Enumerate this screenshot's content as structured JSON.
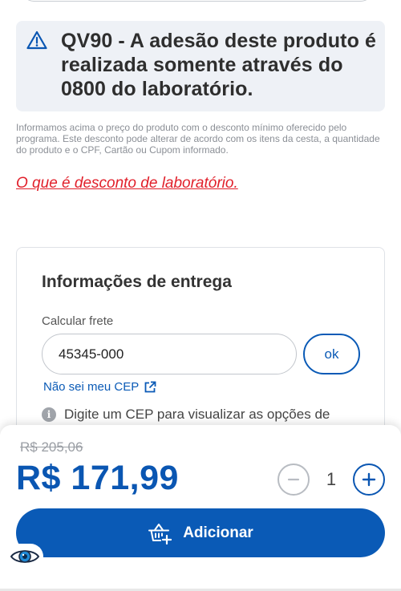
{
  "alert": {
    "icon": "warning-triangle-icon",
    "message": "QV90 - A adesão deste produto é realizada somente através do 0800 do laboratório."
  },
  "disclaimer": "Informamos acima o preço do produto com o desconto mínimo oferecido pelo programa. Este desconto pode alterar de acordo com os itens da cesta, a quantidade do produto e o CPF, Cartão ou Cupom informado.",
  "lab_discount_link": "O que é desconto de laboratório.",
  "delivery": {
    "title": "Informações de entrega",
    "freight_label": "Calcular frete",
    "cep_value": "45345-000",
    "ok_label": "ok",
    "unknown_cep_link": "Não sei meu CEP",
    "info_text": "Digite um CEP para visualizar as opções de"
  },
  "purchase": {
    "old_price": "R$ 205,06",
    "price": "R$ 171,99",
    "quantity": "1",
    "add_label": "Adicionar"
  },
  "colors": {
    "brand_blue": "#0a5ab6",
    "link_red": "#e11f2a",
    "alert_bg": "#eef1f6"
  }
}
